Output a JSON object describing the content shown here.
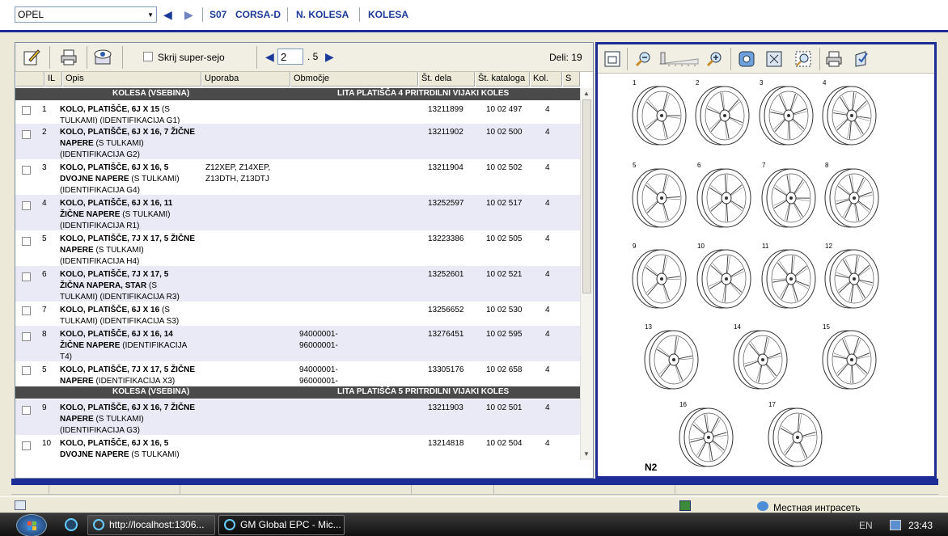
{
  "topbar": {
    "brand_value": "OPEL",
    "crumbs": [
      "S07",
      "CORSA-D",
      "N. KOLESA",
      "KOLESA"
    ]
  },
  "toolbar": {
    "hide_super_label": "Skrij super-sejo",
    "page_value": "2",
    "page_total": ". 5",
    "parts_count": "Deli: 19"
  },
  "table": {
    "columns": [
      "IL",
      "Opis",
      "Uporaba",
      "Območje",
      "Št. dela",
      "Št. kataloga",
      "Kol.",
      "S"
    ],
    "groups": [
      {
        "left": "KOLESA (VSEBINA)",
        "right": "LITA PLATIŠČA 4 PRITRDILNI VIJAKI KOLES"
      },
      {
        "left": "KOLESA (VSEBINA)",
        "right": "LITA PLATIŠČA 5 PRITRDILNI VIJAKI KOLES"
      }
    ],
    "rows": [
      {
        "il": "1",
        "d1": "KOLO, PLATIŠČE, 6J X 15",
        "d1n": "(S",
        "d2": "TULKAMI)  (IDENTIFIKACIJA G1)",
        "d2b": "",
        "d3": "",
        "use": [
          "",
          "",
          ""
        ],
        "area": [
          "",
          ""
        ],
        "part": "13211899",
        "cat": "10 02 497",
        "qty": "4"
      },
      {
        "il": "2",
        "d1": "KOLO, PLATIŠČE, 6J X 16, 7 ŽIČNE",
        "d1n": "",
        "d2": "(S TULKAMI)",
        "d2b": "NAPERE",
        "d3": "(IDENTIFIKACIJA G2)",
        "use": [
          "",
          "",
          ""
        ],
        "area": [
          "",
          ""
        ],
        "part": "13211902",
        "cat": "10 02 500",
        "qty": "4"
      },
      {
        "il": "3",
        "d1": "KOLO, PLATIŠČE, 6J X 16, 5",
        "d1n": "",
        "d2": "(S TULKAMI)",
        "d2b": "DVOJNE NAPERE",
        "d3": "(IDENTIFIKACIJA G4)",
        "use": [
          "Z12XEP, Z14XEP,",
          "Z13DTH, Z13DTJ",
          ""
        ],
        "area": [
          "",
          ""
        ],
        "part": "13211904",
        "cat": "10 02 502",
        "qty": "4"
      },
      {
        "il": "4",
        "d1": "KOLO, PLATIŠČE, 6J X 16, 11",
        "d1n": "",
        "d2": "(S TULKAMI)",
        "d2b": "ŽIČNE NAPERE",
        "d3": "(IDENTIFIKACIJA R1)",
        "use": [
          "",
          "",
          ""
        ],
        "area": [
          "",
          ""
        ],
        "part": "13252597",
        "cat": "10 02 517",
        "qty": "4"
      },
      {
        "il": "5",
        "d1": "KOLO, PLATIŠČE, 7J X 17, 5 ŽIČNE",
        "d1n": "",
        "d2": "(S TULKAMI)",
        "d2b": "NAPERE",
        "d3": "(IDENTIFIKACIJA H4)",
        "use": [
          "",
          "",
          ""
        ],
        "area": [
          "",
          ""
        ],
        "part": "13223386",
        "cat": "10 02 505",
        "qty": "4"
      },
      {
        "il": "6",
        "d1": "KOLO, PLATIŠČE, 7J X 17, 5",
        "d1n": "",
        "d2": "(S",
        "d2b": "ŽIČNA NAPERA, STAR",
        "d3": "TULKAMI)  (IDENTIFIKACIJA R3)",
        "use": [
          "",
          "",
          ""
        ],
        "area": [
          "",
          ""
        ],
        "part": "13252601",
        "cat": "10 02 521",
        "qty": "4"
      },
      {
        "il": "7",
        "d1": "KOLO, PLATIŠČE, 6J X 16",
        "d1n": "(S",
        "d2": "TULKAMI)  (IDENTIFIKACIJA S3)",
        "d2b": "",
        "d3": "",
        "use": [
          "",
          "",
          ""
        ],
        "area": [
          "",
          ""
        ],
        "part": "13256652",
        "cat": "10 02 530",
        "qty": "4"
      },
      {
        "il": "8",
        "d1": "KOLO, PLATIŠČE, 6J X 16, 14",
        "d1n": "",
        "d2": "(IDENTIFIKACIJA",
        "d2b": "ŽIČNE NAPERE",
        "d3": "T4)",
        "use": [
          "",
          "",
          ""
        ],
        "area": [
          "94000001-",
          "96000001-"
        ],
        "part": "13276451",
        "cat": "10 02 595",
        "qty": "4"
      },
      {
        "il": "5",
        "d1": "KOLO, PLATIŠČE, 7J X 17, 5 ŽIČNE",
        "d1n": "",
        "d2": "(IDENTIFIKACIJA X3)",
        "d2b": "NAPERE",
        "d3": "",
        "use": [
          "",
          "",
          ""
        ],
        "area": [
          "94000001-",
          "96000001-"
        ],
        "part": "13305176",
        "cat": "10 02 658",
        "qty": "4"
      },
      {
        "il": "9",
        "d1": "KOLO, PLATIŠČE, 6J X 16, 7 ŽIČNE",
        "d1n": "",
        "d2": "(S TULKAMI)",
        "d2b": "NAPERE",
        "d3": "(IDENTIFIKACIJA G3)",
        "use": [
          "",
          "",
          ""
        ],
        "area": [
          "",
          ""
        ],
        "part": "13211903",
        "cat": "10 02 501",
        "qty": "4"
      },
      {
        "il": "10",
        "d1": "KOLO, PLATIŠČE, 6J X 16, 5",
        "d1n": "",
        "d2": "(S TULKAMI)",
        "d2b": "DVOJNE NAPERE",
        "d3": "",
        "use": [
          "",
          "",
          ""
        ],
        "area": [
          "",
          ""
        ],
        "part": "13214818",
        "cat": "10 02 504",
        "qty": "4"
      }
    ]
  },
  "diagram": {
    "label": "N2",
    "wheel_numbers": [
      "1",
      "2",
      "3",
      "4",
      "5",
      "6",
      "7",
      "8",
      "9",
      "10",
      "11",
      "12",
      "13",
      "14",
      "15",
      "16",
      "17"
    ]
  },
  "status": {
    "zone": "Местная интрасеть"
  },
  "taskbar": {
    "tasks": [
      "http://localhost:1306...",
      "GM Global EPC - Mic..."
    ],
    "lang": "EN",
    "clock": "23:43"
  },
  "colors": {
    "accent": "#1c2d95",
    "group_bg": "#4a4a4a",
    "alt_row": "#eaeaf6"
  }
}
